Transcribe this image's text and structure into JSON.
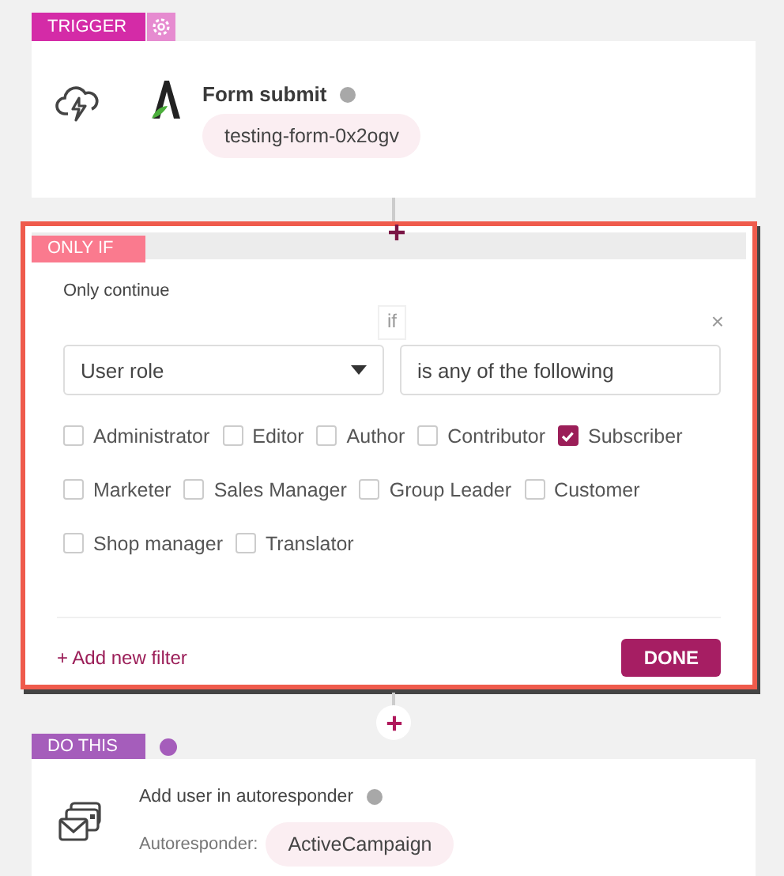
{
  "trigger": {
    "tag": "TRIGGER",
    "title": "Form submit",
    "form": "testing-form-0x2ogv"
  },
  "condition": {
    "tag": "ONLY IF",
    "heading": "Only continue",
    "operator": "if",
    "close": "×",
    "field": {
      "value": "User role"
    },
    "comparison": {
      "value": "is any of the following"
    },
    "options": [
      [
        {
          "label": "Administrator",
          "checked": false
        },
        {
          "label": "Editor",
          "checked": false
        },
        {
          "label": "Author",
          "checked": false
        },
        {
          "label": "Contributor",
          "checked": false
        },
        {
          "label": "Subscriber",
          "checked": true
        }
      ],
      [
        {
          "label": "Marketer",
          "checked": false
        },
        {
          "label": "Sales Manager",
          "checked": false
        },
        {
          "label": "Group Leader",
          "checked": false
        },
        {
          "label": "Customer",
          "checked": false
        }
      ],
      [
        {
          "label": "Shop manager",
          "checked": false
        },
        {
          "label": "Translator",
          "checked": false
        }
      ]
    ],
    "add_filter": "+ Add new filter",
    "done": "DONE"
  },
  "action": {
    "tag": "DO THIS",
    "title": "Add user in autoresponder",
    "label": "Autoresponder:",
    "value": "ActiveCampaign"
  }
}
